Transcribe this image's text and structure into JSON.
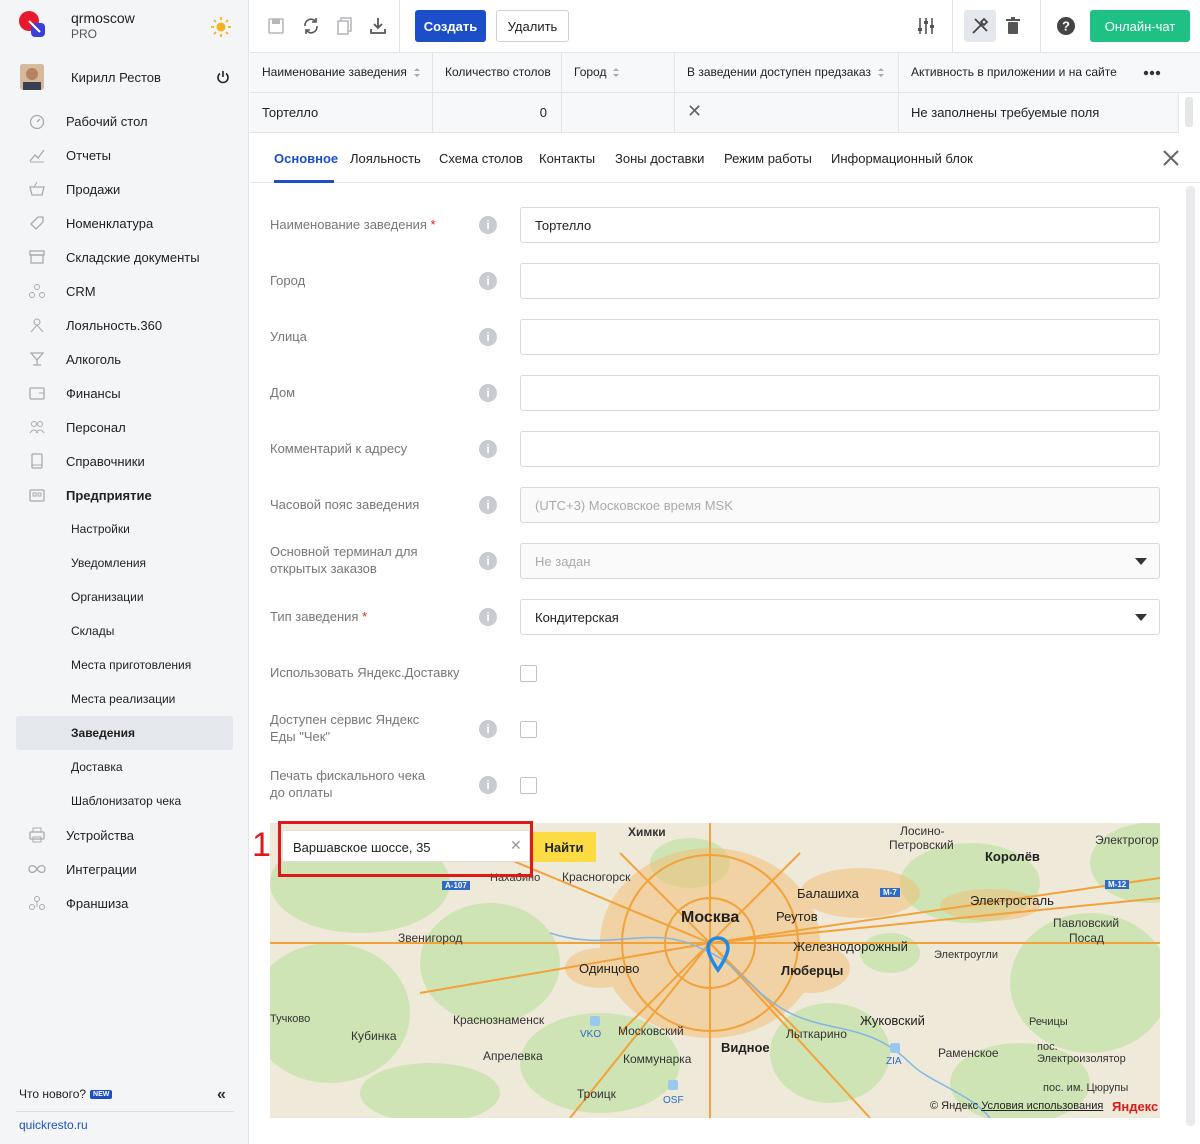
{
  "brand": {
    "name": "qrmoscow",
    "plan": "PRO"
  },
  "user": {
    "name": "Кирилл Рестов"
  },
  "nav": [
    {
      "label": "Рабочий стол",
      "icon": "dashboard-icon"
    },
    {
      "label": "Отчеты",
      "icon": "reports-icon"
    },
    {
      "label": "Продажи",
      "icon": "sales-basket-icon"
    },
    {
      "label": "Номенклатура",
      "icon": "tag-icon"
    },
    {
      "label": "Складские документы",
      "icon": "archive-icon"
    },
    {
      "label": "CRM",
      "icon": "crm-icon"
    },
    {
      "label": "Лояльность.360",
      "icon": "loyalty-icon"
    },
    {
      "label": "Алкоголь",
      "icon": "glass-icon"
    },
    {
      "label": "Финансы",
      "icon": "wallet-icon"
    },
    {
      "label": "Персонал",
      "icon": "staff-icon"
    },
    {
      "label": "Справочники",
      "icon": "book-icon"
    },
    {
      "label": "Предприятие",
      "icon": "enterprise-icon"
    }
  ],
  "subnav": [
    {
      "label": "Настройки"
    },
    {
      "label": "Уведомления"
    },
    {
      "label": "Организации"
    },
    {
      "label": "Склады"
    },
    {
      "label": "Места приготовления"
    },
    {
      "label": "Места реализации"
    },
    {
      "label": "Заведения"
    },
    {
      "label": "Доставка"
    },
    {
      "label": "Шаблонизатор чека"
    }
  ],
  "nav_bottom": [
    {
      "label": "Устройства",
      "icon": "printer-icon"
    },
    {
      "label": "Интеграции",
      "icon": "infinity-icon"
    },
    {
      "label": "Франшиза",
      "icon": "franchise-icon"
    }
  ],
  "footer": {
    "whatsnew": "Что нового?",
    "badge": "NEW",
    "link": "quickresto.ru"
  },
  "toolbar": {
    "create": "Создать",
    "delete": "Удалить",
    "chat": "Онлайн-чат"
  },
  "grid": {
    "headers": [
      "Наименование заведения",
      "Количество столов",
      "Город",
      "В заведении доступен предзаказ",
      "Активность в приложении и на сайте"
    ],
    "row": {
      "name": "Тортелло",
      "tables": "0",
      "city": "",
      "preorder": "✕",
      "activity": "Не заполнены требуемые поля"
    }
  },
  "tabs": [
    "Основное",
    "Лояльность",
    "Схема столов",
    "Контакты",
    "Зоны доставки",
    "Режим работы",
    "Информационный блок"
  ],
  "form": {
    "name_label": "Наименование заведения",
    "name_value": "Тортелло",
    "city_label": "Город",
    "street_label": "Улица",
    "house_label": "Дом",
    "comment_label": "Комментарий к адресу",
    "tz_label": "Часовой пояс заведения",
    "tz_placeholder": "(UTC+3) Московское время MSK",
    "terminal_label_1": "Основной терминал для",
    "terminal_label_2": "открытых заказов",
    "terminal_value": "Не задан",
    "type_label": "Тип заведения",
    "type_value": "Кондитерская",
    "yandex_delivery_label": "Использовать Яндекс.Доставку",
    "yandex_check_label_1": "Доступен сервис Яндекс",
    "yandex_check_label_2": "Еды \"Чек\"",
    "fiscal_label_1": "Печать фискального чека",
    "fiscal_label_2": "до оплаты"
  },
  "map": {
    "search_value": "Варшавское шоссе, 35",
    "find_button": "Найти",
    "annotation": "1",
    "cities": {
      "moscow": "Москва",
      "khimki": "Химки",
      "krasnogorsk": "Красногорск",
      "balashikha": "Балашиха",
      "reutov": "Реутов",
      "zheleznodorozhny": "Железнодорожный",
      "lyubertsy": "Люберцы",
      "odintsovo": "Одинцово",
      "zvenigorod": "Звенигород",
      "elektrostal": "Электросталь",
      "korolev": "Королёв",
      "losino": "Лосино-",
      "petrovsky": "Петровский",
      "pavlovsky": "Павловский",
      "posad": "Посад",
      "elektrougli": "Электроугли",
      "nakhabino": "Нахабино",
      "tuchkovo": "Тучково",
      "kubinka": "Кубинка",
      "krasnoznamensk": "Краснознаменск",
      "moskovsky": "Московский",
      "aprelevka": "Апрелевка",
      "kommunarka": "Коммунарка",
      "vidnoe": "Видное",
      "lytkarino": "Лыткарино",
      "zhukovsky": "Жуковский",
      "ramenskoe": "Раменское",
      "rechitsy": "Речицы",
      "pos": "пос.",
      "elektroizolyator": "Электроизолятор",
      "tsyurupy": "пос. им. Цюрупы",
      "troitsk": "Троицк",
      "elektrogor": "Электрогор"
    },
    "roads": {
      "a107": "А-107",
      "m7": "М-7",
      "m12": "М-12"
    },
    "airports": {
      "vko": "VKO",
      "zia": "ZIA",
      "osf": "OSF"
    },
    "copyright": "© Яндекс",
    "terms": "Условия использования",
    "logo": "Яндекс"
  }
}
